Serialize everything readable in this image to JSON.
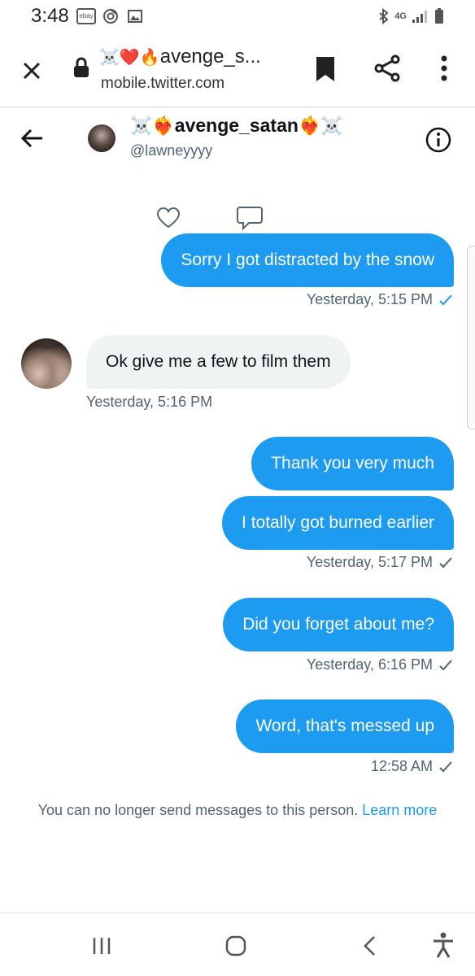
{
  "status_bar": {
    "time": "3:48",
    "ebay_label": "ebay",
    "network": "4G"
  },
  "browser": {
    "title_emoji_prefix": "☠️❤️🔥",
    "title_text": "avenge_s...",
    "url": "mobile.twitter.com"
  },
  "conversation": {
    "name_prefix_emoji": "☠️❤️‍🔥",
    "name": "avenge_satan",
    "name_suffix_emoji": "❤️‍🔥☠️",
    "handle": "@lawneyyyy"
  },
  "messages": [
    {
      "direction": "out",
      "text": "Sorry I got distracted by the snow"
    },
    {
      "direction": "in",
      "text": "Ok give me a few to film them"
    },
    {
      "direction": "out",
      "text": "Thank you very much"
    },
    {
      "direction": "out",
      "text": "I totally got burned earlier"
    },
    {
      "direction": "out",
      "text": "Did you forget about me?"
    },
    {
      "direction": "out",
      "text": "Word, that's messed up"
    }
  ],
  "timestamps": {
    "t1": "Yesterday, 5:15 PM",
    "t2": "Yesterday, 5:16 PM",
    "t3": "Yesterday, 5:17 PM",
    "t4": "Yesterday, 6:16 PM",
    "t5": "12:58 AM"
  },
  "footer": {
    "notice": "You can no longer send messages to this person.",
    "learn_more": "Learn more"
  },
  "colors": {
    "accent": "#1d9bf0",
    "incoming_bubble": "#eff3f4",
    "secondary_text": "#536471"
  }
}
